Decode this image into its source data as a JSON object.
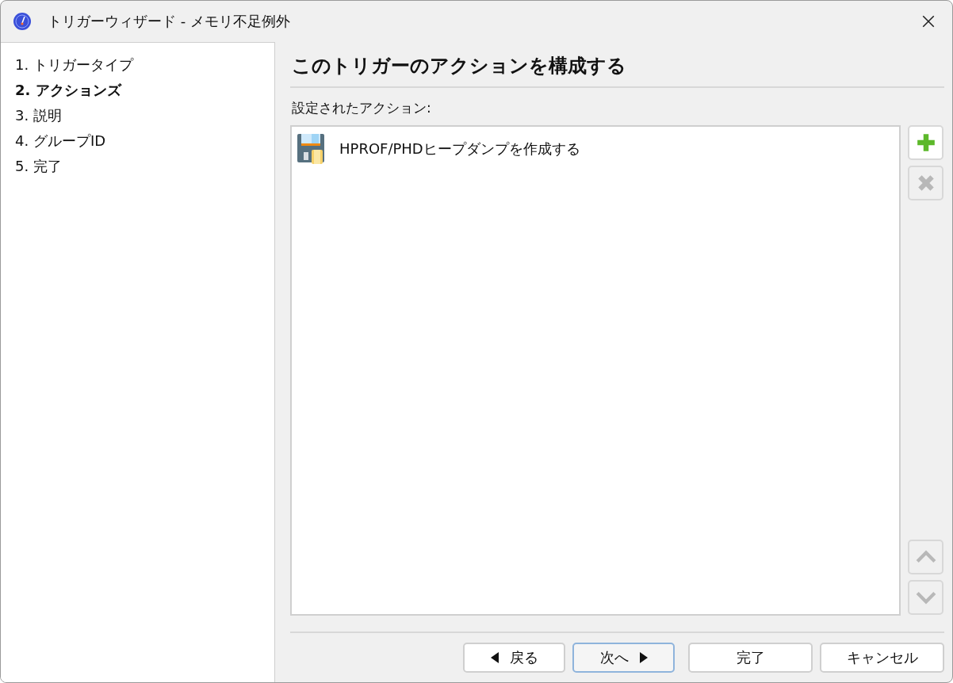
{
  "window": {
    "title": "トリガーウィザード - メモリ不足例外"
  },
  "steps": [
    {
      "label": "1. トリガータイプ",
      "selected": false
    },
    {
      "label": "2. アクションズ",
      "selected": true
    },
    {
      "label": "3. 説明",
      "selected": false
    },
    {
      "label": "4. グループID",
      "selected": false
    },
    {
      "label": "5. 完了",
      "selected": false
    }
  ],
  "heading": "このトリガーのアクションを構成する",
  "actions_label": "設定されたアクション:",
  "actions": [
    {
      "label": "HPROF/PHDヒープダンプを作成する"
    }
  ],
  "side_buttons": [
    {
      "kind": "add",
      "disabled": false
    },
    {
      "kind": "remove",
      "disabled": true
    },
    {
      "kind": "up",
      "disabled": true
    },
    {
      "kind": "down",
      "disabled": true
    }
  ],
  "footer_buttons": [
    {
      "kind": "back",
      "label": "戻る",
      "focused": false
    },
    {
      "kind": "next",
      "label": "次へ",
      "focused": true
    },
    {
      "kind": "plain",
      "label": "完了",
      "focused": false
    },
    {
      "kind": "plain",
      "label": "キャンセル",
      "focused": false
    }
  ]
}
